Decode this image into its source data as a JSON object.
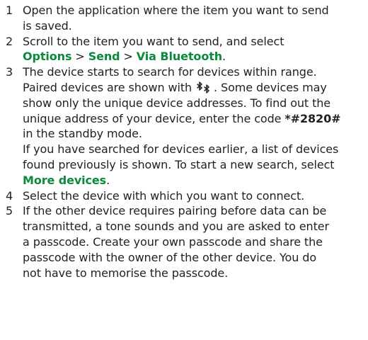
{
  "steps": [
    {
      "num": "1",
      "l1": "Open the application where the item you want to send",
      "l2": "is saved."
    },
    {
      "num": "2",
      "l1": "Scroll to the item you want to send, and select",
      "opt_options": "Options",
      "sep1": " > ",
      "opt_send": "Send",
      "sep2": " > ",
      "opt_via": "Via Bluetooth",
      "end": "."
    },
    {
      "num": "3",
      "l1": "The device starts to search for devices within range.",
      "l2a": "Paired devices are shown with ",
      "paired_icon": "bluetooth-paired-icon",
      "l2b": ". Some devices may",
      "l3": "show only the unique device addresses. To find out the",
      "l4": "unique address of your device, enter the code ",
      "code": "*#2820#",
      "l5": "in the standby mode.",
      "l6": "If you have searched for devices earlier, a list of devices",
      "l7": "found previously is shown. To start a new search, select",
      "opt_more": "More devices",
      "end": "."
    },
    {
      "num": "4",
      "l1": "Select the device with which you want to connect."
    },
    {
      "num": "5",
      "l1": "If the other device requires pairing before data can be",
      "l2": "transmitted, a tone sounds and you are asked to enter",
      "l3": "a passcode. Create your own passcode and share the",
      "l4": "passcode with the owner of the other device. You do",
      "l5": "not have to memorise the passcode."
    }
  ],
  "colors": {
    "text": "#231f20",
    "ui_label": "#0a8a3a"
  }
}
